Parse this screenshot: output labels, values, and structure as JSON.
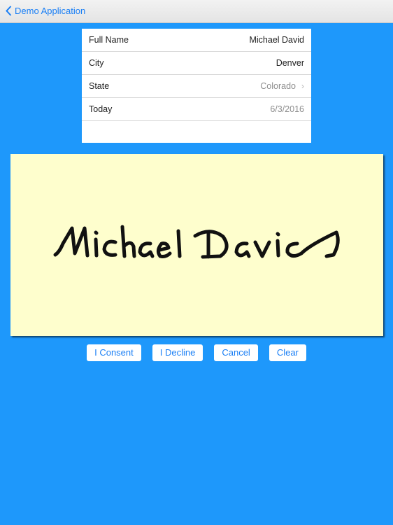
{
  "navbar": {
    "back_label": "Demo Application"
  },
  "form": {
    "rows": [
      {
        "label": "Full Name",
        "value": "Michael David"
      },
      {
        "label": "City",
        "value": "Denver"
      },
      {
        "label": "State",
        "value": "Colorado"
      },
      {
        "label": "Today",
        "value": "6/3/2016"
      }
    ]
  },
  "signature": {
    "text": "Michael David",
    "background": "#fefecd"
  },
  "buttons": {
    "consent": "I Consent",
    "decline": "I Decline",
    "cancel": "Cancel",
    "clear": "Clear"
  },
  "colors": {
    "accent": "#1a7ff5",
    "background": "#1e98fb"
  }
}
